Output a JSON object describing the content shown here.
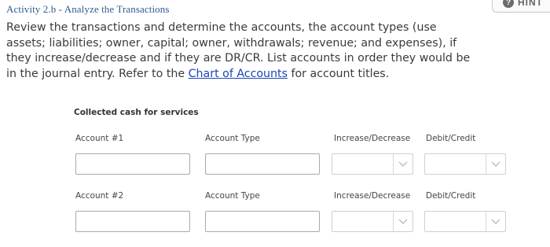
{
  "header": {
    "activity_title": "Activity 2.b - Analyze the Transactions",
    "hint_label": "HINT",
    "hint_icon": "question-circle-icon"
  },
  "instructions": {
    "text_before_link": "Review the transactions and determine the accounts, the account types (use assets; liabilities; owner, capital; owner, withdrawals; revenue; and expenses), if they increase/decrease and if they are DR/CR. List accounts in order they would be in the journal entry. Refer to the ",
    "link_text": "Chart of Accounts",
    "text_after_link": " for account titles."
  },
  "transaction": {
    "title": "Collected cash for services",
    "rows": [
      {
        "account_label": "Account #1",
        "account_type_label": "Account Type",
        "increase_decrease_label": "Increase/Decrease",
        "debit_credit_label": "Debit/Credit",
        "account_value": "",
        "account_type_value": "",
        "increase_decrease_value": "",
        "debit_credit_value": ""
      },
      {
        "account_label": "Account #2",
        "account_type_label": "Account Type",
        "increase_decrease_label": "Increase/Decrease",
        "debit_credit_label": "Debit/Credit",
        "account_value": "",
        "account_type_value": "",
        "increase_decrease_value": "",
        "debit_credit_value": ""
      }
    ]
  },
  "colors": {
    "activity_title": "#2f5b8f",
    "link": "#1a45b8",
    "field_border": "#a9a9a9"
  }
}
